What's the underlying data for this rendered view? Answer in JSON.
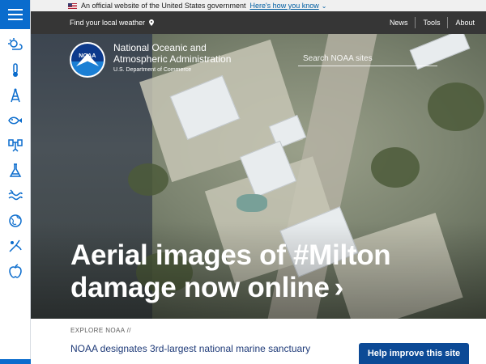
{
  "gov_banner": {
    "text": "An official website of the United States government",
    "link": "Here's how you know"
  },
  "topnav": {
    "weather": "Find your local weather",
    "links": [
      "News",
      "Tools",
      "About"
    ]
  },
  "logo": {
    "seal_text": "NOAA",
    "name_line1": "National Oceanic and",
    "name_line2": "Atmospheric Administration",
    "dept": "U.S. Department of Commerce"
  },
  "search": {
    "placeholder": "Search NOAA sites"
  },
  "hero": {
    "headline_line1": "Aerial images of #Milton",
    "headline_line2": "damage now online"
  },
  "explore": {
    "kicker": "EXPLORE NOAA //",
    "story": "NOAA designates 3rd-largest national marine sanctuary"
  },
  "help_button": "Help improve this site",
  "rail_icons": [
    "weather-icon",
    "thermometer-icon",
    "tower-icon",
    "fish-icon",
    "satellite-icon",
    "flask-icon",
    "coast-icon",
    "globe-icon",
    "fishing-icon",
    "apple-icon"
  ],
  "colors": {
    "accent": "#0a6ccd",
    "nav": "#363636",
    "help": "#0c4a96",
    "link": "#1e3a78"
  }
}
